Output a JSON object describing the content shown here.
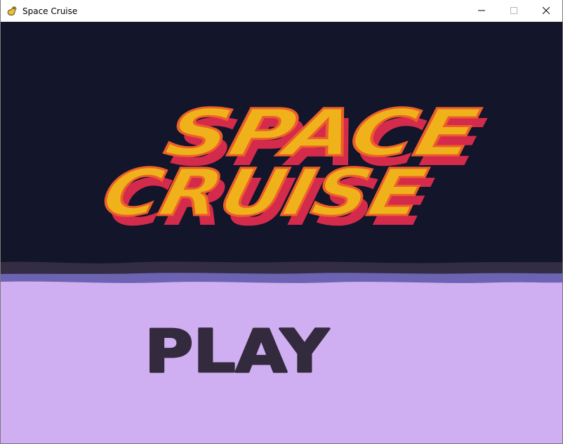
{
  "window": {
    "title": "Space Cruise",
    "icon": "pygame-snake-icon",
    "controls": [
      "minimize-icon",
      "maximize-icon",
      "close-icon"
    ]
  },
  "game": {
    "logo_lines": [
      "SPACE",
      "CRUISE"
    ],
    "play_label": "PLAY",
    "colors": {
      "sky": "#13152a",
      "horizon_dark": "#332d44",
      "horizon_band": "#6c63b2",
      "ground": "#cfaff2",
      "logo_face": "#f0b21a",
      "logo_outline": "#ec5f2a",
      "logo_shadow": "#d42a4c",
      "play_text": "#332b3d"
    }
  }
}
